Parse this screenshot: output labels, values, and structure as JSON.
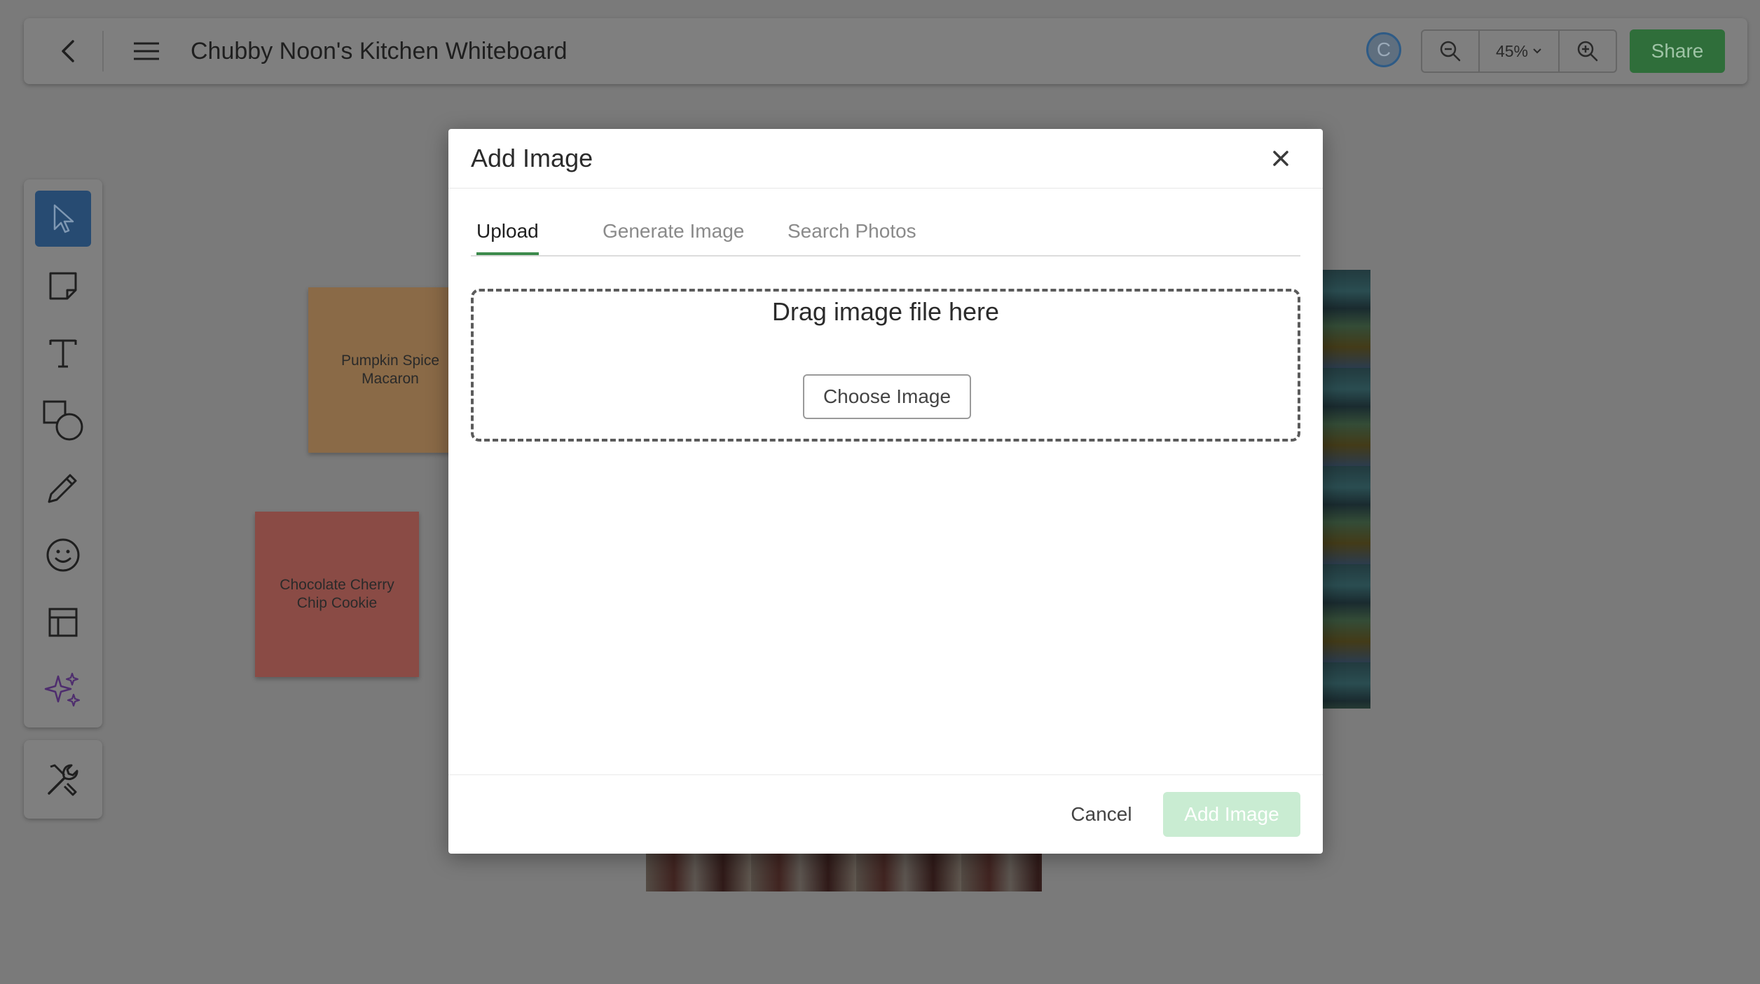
{
  "board": {
    "title": "Chubby Noon's Kitchen Whiteboard",
    "avatar_initial": "C",
    "zoom_level": "45%",
    "share_label": "Share"
  },
  "stickies": [
    {
      "text": "Pumpkin Spice Macaron",
      "color": "#8a6a47"
    },
    {
      "text": "Chocolate Cherry Chip Cookie",
      "color": "#8a4b45"
    }
  ],
  "toolbar": {
    "tools": [
      {
        "icon": "cursor-icon",
        "active": true
      },
      {
        "icon": "sticky-note-icon",
        "active": false
      },
      {
        "icon": "text-icon",
        "active": false
      },
      {
        "icon": "shapes-icon",
        "active": false
      },
      {
        "icon": "pencil-icon",
        "active": false
      },
      {
        "icon": "emoji-icon",
        "active": false
      },
      {
        "icon": "template-icon",
        "active": false
      },
      {
        "icon": "ai-sparkle-icon",
        "active": false
      }
    ],
    "extra_icon": "tools-icon"
  },
  "modal": {
    "title": "Add Image",
    "tabs": [
      {
        "label": "Upload",
        "active": true
      },
      {
        "label": "Generate Image",
        "active": false
      },
      {
        "label": "Search Photos",
        "active": false
      }
    ],
    "dropzone": {
      "text": "Drag image file here",
      "button_label": "Choose Image"
    },
    "cancel_label": "Cancel",
    "confirm_label": "Add Image"
  },
  "colors": {
    "accent_green": "#3c8a4c",
    "share_bg": "#2f6e3a",
    "active_tool": "#274b72",
    "disabled_add": "#c9ecd2"
  }
}
